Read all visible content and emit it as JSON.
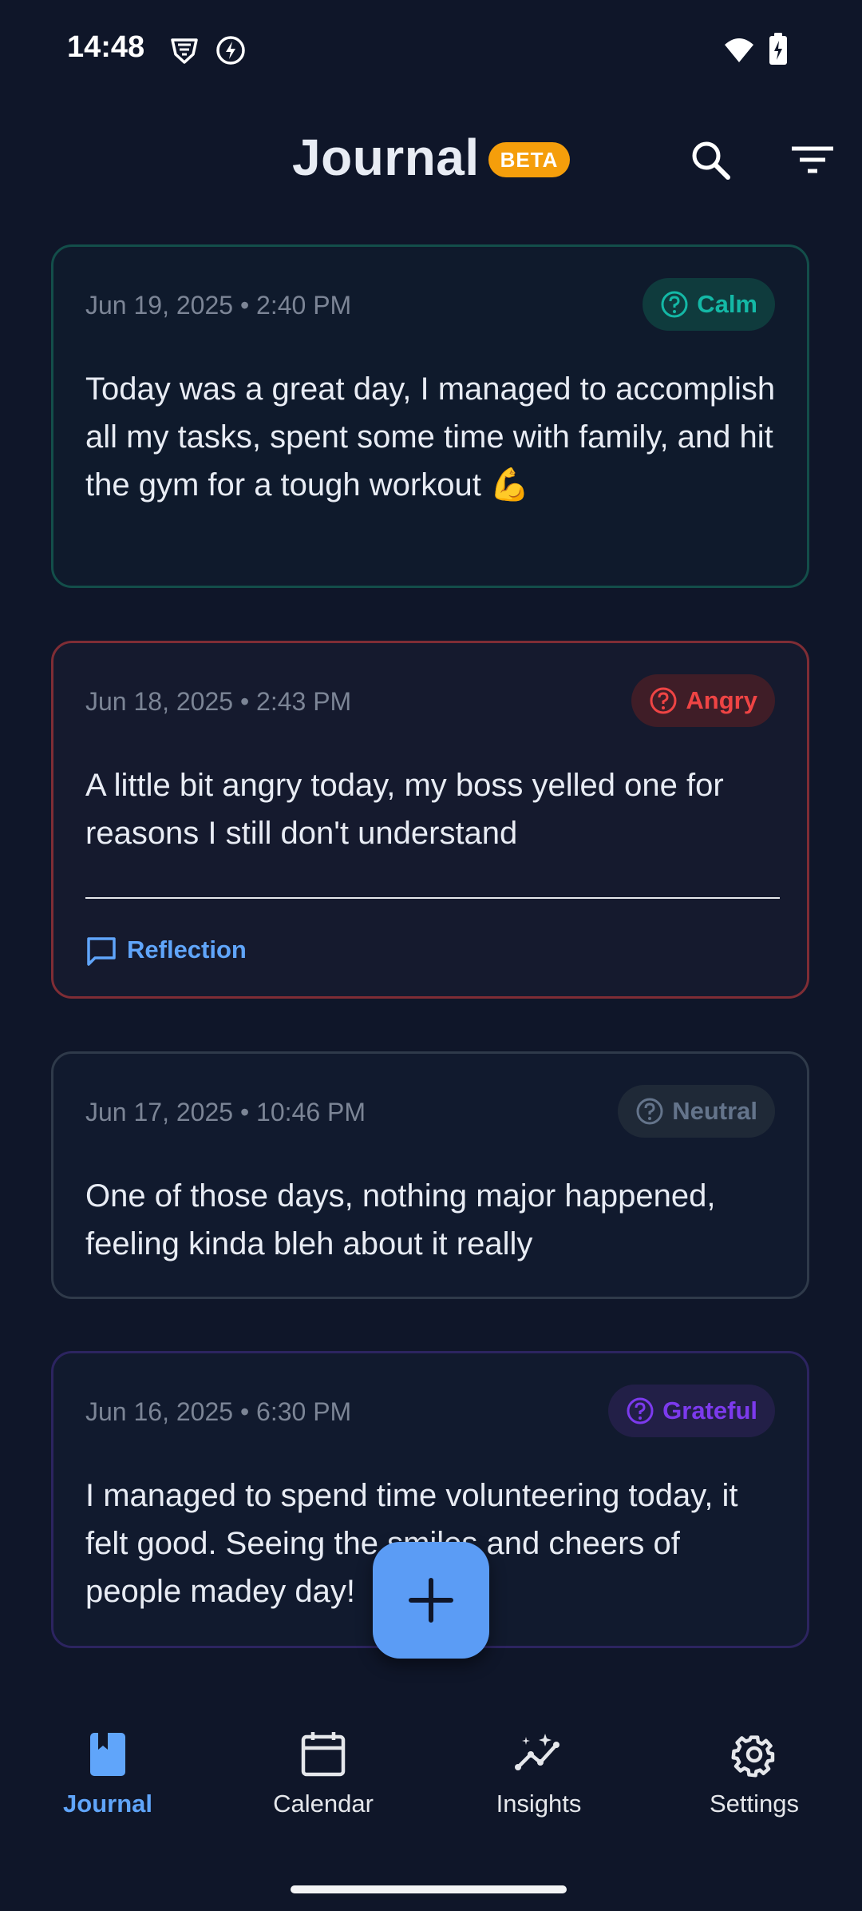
{
  "status_bar": {
    "time": "14:48"
  },
  "header": {
    "title": "Journal",
    "badge": "BETA",
    "search_icon": "search-icon",
    "filter_icon": "filter-icon"
  },
  "entries": [
    {
      "date": "Jun 19, 2025 • 2:40 PM",
      "mood": "Calm",
      "mood_color": "#14b8a6",
      "text": "Today was a great day, I managed to accomplish all my tasks, spent some time with family, and hit the gym for a tough workout 💪"
    },
    {
      "date": "Jun 18, 2025 • 2:43 PM",
      "mood": "Angry",
      "mood_color": "#ef4444",
      "text": "A little bit angry today, my boss yelled one for reasons I still don't understand",
      "reflection_label": "Reflection"
    },
    {
      "date": "Jun 17, 2025 • 10:46 PM",
      "mood": "Neutral",
      "mood_color": "#64748b",
      "text": "One of those days, nothing major happened, feeling kinda bleh about it really"
    },
    {
      "date": "Jun 16, 2025 • 6:30 PM",
      "mood": "Grateful",
      "mood_color": "#7c3aed",
      "text": "I managed to spend time volunteering today, it felt good. Seeing the smiles and cheers of people madey day!"
    }
  ],
  "fab": {
    "icon": "plus-icon"
  },
  "nav": {
    "items": [
      {
        "label": "Journal",
        "icon": "book-icon",
        "active": true
      },
      {
        "label": "Calendar",
        "icon": "calendar-icon",
        "active": false
      },
      {
        "label": "Insights",
        "icon": "insights-icon",
        "active": false
      },
      {
        "label": "Settings",
        "icon": "gear-icon",
        "active": false
      }
    ]
  },
  "colors": {
    "background": "#0f1629",
    "accent": "#60a5fa",
    "beta": "#f59e0b"
  }
}
